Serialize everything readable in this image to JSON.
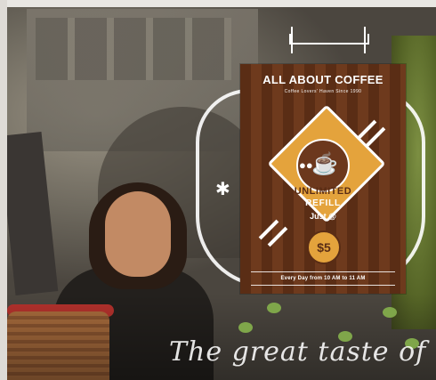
{
  "poster": {
    "title": "ALL ABOUT COFFEE",
    "subtitle": "Coffee Lovers' Haven Since 1990",
    "headline": "UNLIMITED",
    "headline2": "REFILL",
    "just": "Just @",
    "price": "$5",
    "footer": "Every Day from 10 AM to 11 AM"
  },
  "window_text": "The great taste of Tu",
  "colors": {
    "poster_brown": "#5a2d15",
    "poster_gold": "#e4a33c"
  },
  "icons": [
    "coffee-cup-icon",
    "coffee-beans-icon",
    "asterisk-icon",
    "flag-banner-icon"
  ]
}
